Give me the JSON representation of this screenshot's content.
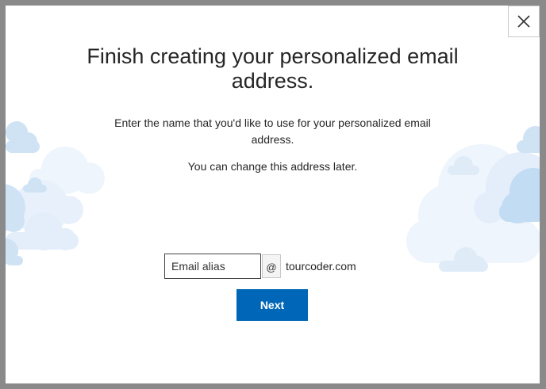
{
  "dialog": {
    "title": "Finish creating your personalized email address.",
    "description": "Enter the name that you'd like to use for your personalized email address.",
    "note": "You can change this address later.",
    "alias_placeholder": "Email alias",
    "alias_value": "",
    "at_symbol": "@",
    "domain": "tourcoder.com",
    "next_label": "Next",
    "close_icon": "close-icon"
  },
  "colors": {
    "accent": "#0067b8",
    "cloud_light": "#eef5fc",
    "cloud_mid": "#cfe3f5",
    "cloud_dark": "#c2dcf3",
    "overlay": "#8a8a8a"
  }
}
